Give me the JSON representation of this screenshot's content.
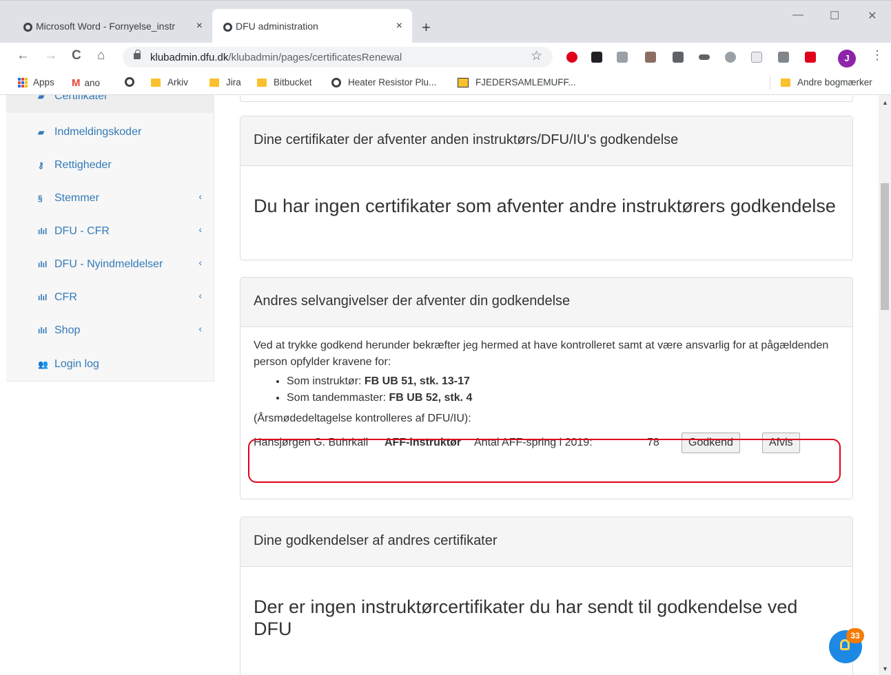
{
  "browser": {
    "tabs": [
      {
        "title": "Microsoft Word - Fornyelse_instr",
        "close": "×"
      },
      {
        "title": "DFU administration",
        "close": "×"
      }
    ],
    "new_tab": "+",
    "window_controls": {
      "minimize": "—",
      "maximize": "☐",
      "close": "✕"
    },
    "nav": {
      "back": "←",
      "forward": "→",
      "reload": "C",
      "home": "⌂"
    },
    "url_domain": "klubadmin.dfu.dk",
    "url_path": "/klubadmin/pages/certificatesRenewal",
    "bookmark_star": "☆",
    "profile_initial": "J",
    "menu": "⋮",
    "bookmarks": [
      {
        "label": "Apps",
        "icon": "apps-grid-icon"
      },
      {
        "label": "ano",
        "icon": "gmail-icon",
        "glyph": "M"
      },
      {
        "label": "",
        "icon": "globe-icon"
      },
      {
        "label": "Arkiv",
        "icon": "folder-icon"
      },
      {
        "label": "Jira",
        "icon": "folder-icon"
      },
      {
        "label": "Bitbucket",
        "icon": "folder-icon"
      },
      {
        "label": "Heater Resistor Plu...",
        "icon": "globe-icon"
      },
      {
        "label": "FJEDERSAMLEMUFF...",
        "icon": "fjeder-icon"
      }
    ],
    "other_bookmarks": "Andre bogmærker"
  },
  "sidebar": {
    "items": [
      {
        "label": "Certifikater",
        "icon": "certificate-icon",
        "glyph": "▰",
        "chevron": ""
      },
      {
        "label": "Indmeldingskoder",
        "icon": "book-icon",
        "glyph": "▰",
        "chevron": ""
      },
      {
        "label": "Rettigheder",
        "icon": "key-icon",
        "glyph": "⚷",
        "chevron": ""
      },
      {
        "label": "Stemmer",
        "icon": "section-icon",
        "glyph": "§",
        "chevron": "‹"
      },
      {
        "label": "DFU - CFR",
        "icon": "bar-chart-icon",
        "glyph": "ılıl",
        "chevron": "‹"
      },
      {
        "label": "DFU - Nyindmeldelser",
        "icon": "bar-chart-icon",
        "glyph": "ılıl",
        "chevron": "‹"
      },
      {
        "label": "CFR",
        "icon": "bar-chart-icon",
        "glyph": "ılıl",
        "chevron": "‹"
      },
      {
        "label": "Shop",
        "icon": "bar-chart-icon",
        "glyph": "ılıl",
        "chevron": "‹"
      },
      {
        "label": "Login log",
        "icon": "users-icon",
        "glyph": "👥",
        "chevron": ""
      }
    ]
  },
  "panels": {
    "pending_others": {
      "heading": "Dine certifikater der afventer anden instruktørs/DFU/IU's godkendelse",
      "message": "Du har ingen certifikater som afventer andre instruktørers godkendelse"
    },
    "awaiting_my_approval": {
      "heading": "Andres selvangivelser der afventer din godkendelse",
      "intro": "Ved at trykke godkend herunder bekræfter jeg hermed at have kontrolleret samt at være ansvarlig for at pågældenden person opfylder kravene for:",
      "requirements": [
        {
          "prefix": "Som instruktør: ",
          "rule": "FB UB 51, stk. 13-17"
        },
        {
          "prefix": "Som tandemmaster: ",
          "rule": "FB UB 52, stk. 4"
        }
      ],
      "note": "(Årsmødedeltagelse kontrolleres af DFU/IU):",
      "request": {
        "name": "Hansjørgen G. Buhrkall",
        "role": "AFF-instruktør",
        "jumps_label": "Antal AFF-spring i 2019:",
        "jumps_value": "78",
        "approve_label": "Godkend",
        "reject_label": "Afvis"
      }
    },
    "my_approvals": {
      "heading": "Dine godkendelser af andres certifikater",
      "message": "Der er ingen instruktørcertifikater du har sendt til godkendelse ved DFU"
    }
  },
  "help_badge_count": "33",
  "colors": {
    "link": "#337ab7",
    "highlight": "#e0001b",
    "profile": "#8e24aa",
    "fab": "#1e88e5",
    "badge": "#f57c00"
  }
}
